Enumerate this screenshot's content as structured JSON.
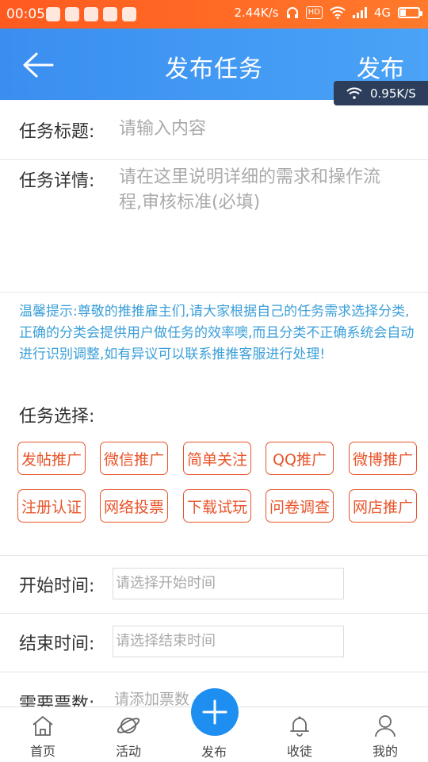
{
  "status_bar": {
    "time": "00:05",
    "speed": "2.44K/s",
    "hd_label": "HD",
    "network": "4G",
    "battery_level": 0.3
  },
  "header": {
    "title": "发布任务",
    "action_label": "发布",
    "network_overlay": "0.95K/S"
  },
  "form": {
    "title_label": "任务标题:",
    "title_placeholder": "请输入内容",
    "detail_label": "任务详情:",
    "detail_placeholder_line1": "请在这里说明详细的需求和操作流",
    "detail_placeholder_line2": "程,审核标准(必填)",
    "tip_text": "温馨提示:尊敬的推推雇主们,请大家根据自己的任务需求选择分类,正确的分类会提供用户做任务的效率噢,而且分类不正确系统会自动进行识别调整,如有异议可以联系推推客服进行处理!",
    "task_select_label": "任务选择:",
    "categories": [
      "发帖推广",
      "微信推广",
      "简单关注",
      "QQ推广",
      "微博推广",
      "注册认证",
      "网络投票",
      "下载试玩",
      "问卷调查",
      "网店推广"
    ],
    "start_label": "开始时间:",
    "start_placeholder": "请选择开始时间",
    "end_label": "结束时间:",
    "end_placeholder": "请选择结束时间",
    "votes_label": "需要票数:",
    "votes_placeholder": "请添加票数"
  },
  "tabbar": {
    "items": [
      {
        "label": "首页",
        "icon": "home-icon"
      },
      {
        "label": "活动",
        "icon": "planet-icon"
      },
      {
        "label": "发布",
        "icon": "plus-icon"
      },
      {
        "label": "收徒",
        "icon": "bell-icon"
      },
      {
        "label": "我的",
        "icon": "user-icon"
      }
    ]
  },
  "colors": {
    "status_bar": "#ff6a24",
    "app_bar": "#3f97f2",
    "tip_text": "#3b9fd8",
    "chip_border": "#e8542a",
    "fab": "#1e8ef0"
  }
}
